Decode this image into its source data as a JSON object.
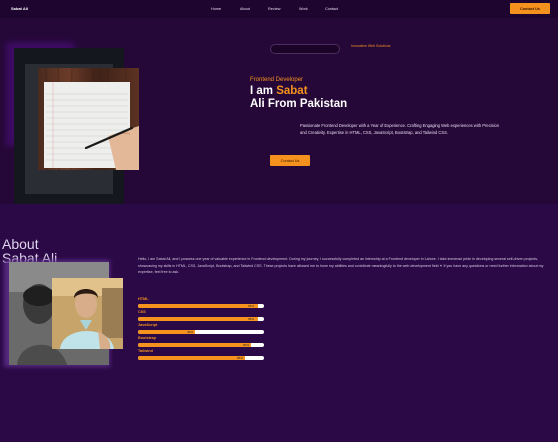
{
  "navbar": {
    "brand": "Sabat Ali",
    "links": [
      "Home",
      "About",
      "Review",
      "Work",
      "Contact"
    ],
    "contact_button": "Contact Us"
  },
  "hero": {
    "tagline": "Innovative Web Solutions",
    "role": "Frontend Developer",
    "heading_prefix": "I am ",
    "heading_name": "Sabat",
    "heading_line2": "Ali From Pakistan",
    "description": "Passionate Frontend Developer with a Year of Experience. Crafting Engaging Web experiences with Precision and Creativity. Expertise in HTML, CSS, JavaScript, Bootstrap, and Tailwind CSS.",
    "cta_button": "Contact Us"
  },
  "about": {
    "title_line1": "About",
    "title_line2": "Sabat Ali",
    "text": "Hello, I am Sabat Ali, and I possess one year of valuable experience in Frontend development. During my journey, I successfully completed an internship at a Frontend developer in Lahore. I take immense pride in developing several self-driven projects, showcasing my skills in HTML, CSS, JavaScript, Bootstrap, and Tailwind CSS. These projects have allowed me to hone my abilities and contribute meaningfully to the web development field ✦ If you have any questions or need further information about my expertise, feel free to ask.",
    "skills": [
      {
        "name": "HTML",
        "percent": 95,
        "label": "95%"
      },
      {
        "name": "CSS",
        "percent": 95,
        "label": "95%"
      },
      {
        "name": "JavaScript",
        "percent": 45,
        "label": "45%"
      },
      {
        "name": "Bootstrap",
        "percent": 90,
        "label": "90%"
      },
      {
        "name": "Tailwind",
        "percent": 85,
        "label": "85%"
      }
    ]
  },
  "colors": {
    "accent": "#f5921e",
    "background": "#27083d",
    "about_background": "#2b0946"
  }
}
